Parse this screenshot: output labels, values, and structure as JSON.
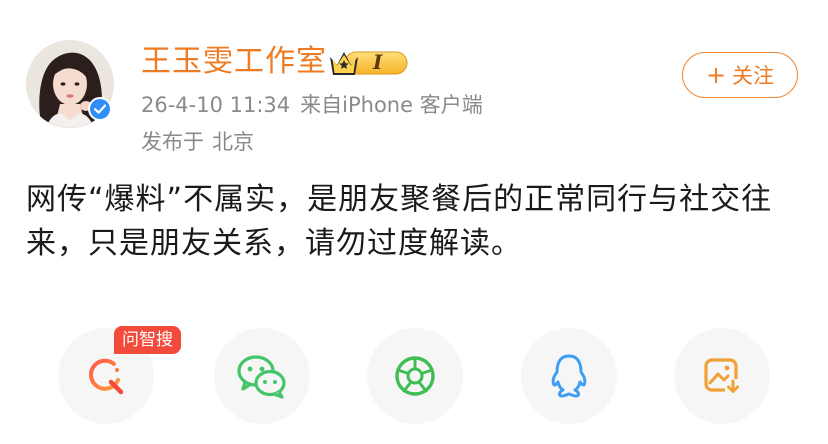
{
  "post": {
    "author": "王玉雯工作室",
    "member_badge_label": "I",
    "time": "26-4-10 11:34",
    "source_prefix": "来自",
    "source_device": "iPhone 客户端",
    "location_prefix": "发布于",
    "location": "北京",
    "follow_label": "关注",
    "text": "网传“爆料”不属实，是朋友聚餐后的正常同行与社交往来，只是朋友关系，请勿过度解读。"
  },
  "share_bar": {
    "ai_search_tag": "问智搜",
    "items": [
      {
        "icon": "ai-search-icon"
      },
      {
        "icon": "wechat-icon"
      },
      {
        "icon": "moments-icon"
      },
      {
        "icon": "qq-icon"
      },
      {
        "icon": "save-image-icon"
      }
    ]
  },
  "colors": {
    "username": "#ef7b22",
    "follow": "#ef7b22",
    "meta_text": "#8a8a8a",
    "body_text": "#1a1a1a",
    "verified": "#2f8ef7",
    "ai_tag": "#f24b3c",
    "wechat": "#46c46a",
    "moments": "#3ebe54",
    "qq": "#3e9ef5",
    "save": "#f0a135"
  }
}
